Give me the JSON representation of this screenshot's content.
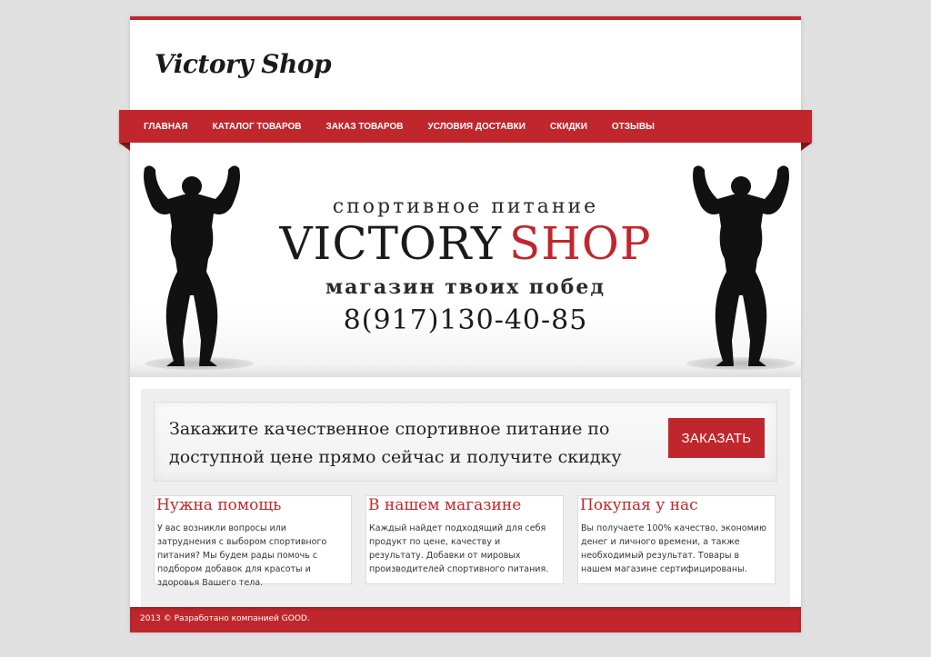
{
  "site": {
    "logo": "Victory Shop",
    "accent_color": "#c0272d"
  },
  "nav": {
    "items": [
      "ГЛАВНАЯ",
      "КАТАЛОГ ТОВАРОВ",
      "ЗАКАЗ ТОВАРОВ",
      "УСЛОВИЯ ДОСТАВКИ",
      "СКИДКИ",
      "ОТЗЫВЫ"
    ]
  },
  "banner": {
    "subtitle": "спортивное питание",
    "title_part1": "VICTORY",
    "title_part2": "SHOP",
    "tagline": "магазин твоих побед",
    "phone": "8(917)130-40-85",
    "icon": "bodybuilder-silhouette"
  },
  "cta": {
    "text": "Закажите качественное спортивное питание по доступной цене прямо сейчас и получите скидку",
    "button_label": "ЗАКАЗАТЬ"
  },
  "columns": [
    {
      "title": "Нужна помощь",
      "text": "У вас возникли вопросы или затруднения с выбором спортивного питания? Мы будем рады помочь с подбором добавок для красоты и здоровья Вашего тела."
    },
    {
      "title": "В нашем магазине",
      "text": "Каждый найдет подходящий для себя продукт по цене, качеству и результату. Добавки от мировых производителей спортивного питания."
    },
    {
      "title": "Покупая у нас",
      "text": "Вы получаете 100% качество, экономию денег и личного времени, а также необходимый результат. Товары в нашем магазине сертифицированы."
    }
  ],
  "footer": {
    "text": "2013 © Разработано компанией GOOD."
  }
}
